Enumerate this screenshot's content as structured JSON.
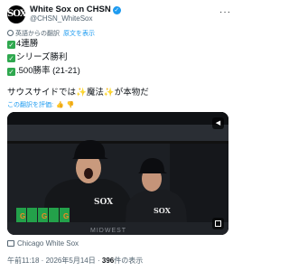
{
  "account": {
    "name": "White Sox on CHSN",
    "handle": "@CHSN_WhiteSox",
    "avatar_text": "SOX"
  },
  "translate": {
    "note": "英語からの翻訳",
    "link": "原文を表示"
  },
  "post": {
    "lines": [
      "4連勝",
      "シリーズ勝利",
      ".500勝率 (21-21)"
    ],
    "text_before": "サウスサイドでは",
    "magic": "魔法",
    "text_after": "が本物だ",
    "emoji": "✨"
  },
  "rate": {
    "label": "この翻訳を評価:"
  },
  "media": {
    "source_label": "Chicago White Sox",
    "board_text": "MIDWEST",
    "sign_text": "G"
  },
  "meta": {
    "time": "午前11:18",
    "date": "2026年5月14日",
    "views": "396",
    "views_label": "件の表示",
    "separator": "·"
  },
  "colors": {
    "accent": "#1d9bf0",
    "check": "#2fa84f",
    "sparkle": "#f2b400"
  }
}
